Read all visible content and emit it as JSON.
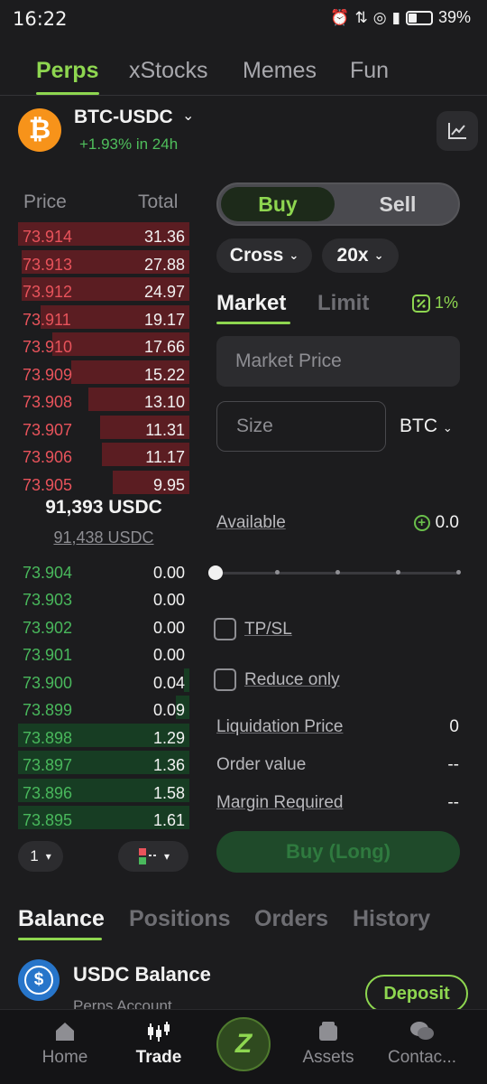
{
  "status_bar": {
    "time": "16:22",
    "battery": "39%"
  },
  "top_tabs": [
    {
      "label": "Perps"
    },
    {
      "label": "xStocks"
    },
    {
      "label": "Memes"
    },
    {
      "label": "Fun"
    }
  ],
  "market": {
    "pair": "BTC-USDC",
    "change": "+1.93% in 24h",
    "coin_icon": "bitcoin-icon"
  },
  "orderbook": {
    "price_header": "Price",
    "total_header": "Total",
    "asks": [
      {
        "price": "73.914",
        "total": "31.36",
        "depth": 1.0
      },
      {
        "price": "73.913",
        "total": "27.88",
        "depth": 0.98
      },
      {
        "price": "73.912",
        "total": "24.97",
        "depth": 0.98
      },
      {
        "price": "73.911",
        "total": "19.17",
        "depth": 0.87
      },
      {
        "price": "73.910",
        "total": "17.66",
        "depth": 0.8
      },
      {
        "price": "73.909",
        "total": "15.22",
        "depth": 0.69
      },
      {
        "price": "73.908",
        "total": "13.10",
        "depth": 0.59
      },
      {
        "price": "73.907",
        "total": "11.31",
        "depth": 0.52
      },
      {
        "price": "73.906",
        "total": "11.17",
        "depth": 0.51
      },
      {
        "price": "73.905",
        "total": "9.95",
        "depth": 0.45
      }
    ],
    "mid_price": "91,393 USDC",
    "mark_price": "91,438 USDC",
    "bids": [
      {
        "price": "73.904",
        "total": "0.00",
        "depth": 0.0
      },
      {
        "price": "73.903",
        "total": "0.00",
        "depth": 0.0
      },
      {
        "price": "73.902",
        "total": "0.00",
        "depth": 0.0
      },
      {
        "price": "73.901",
        "total": "0.00",
        "depth": 0.0
      },
      {
        "price": "73.900",
        "total": "0.04",
        "depth": 0.03
      },
      {
        "price": "73.899",
        "total": "0.09",
        "depth": 0.08
      },
      {
        "price": "73.898",
        "total": "1.29",
        "depth": 1.0
      },
      {
        "price": "73.897",
        "total": "1.36",
        "depth": 1.0
      },
      {
        "price": "73.896",
        "total": "1.58",
        "depth": 1.0
      },
      {
        "price": "73.895",
        "total": "1.61",
        "depth": 1.0
      }
    ],
    "precision_select": "1"
  },
  "order_form": {
    "buy_label": "Buy",
    "sell_label": "Sell",
    "margin_mode": "Cross",
    "leverage": "20x",
    "market_tab": "Market",
    "limit_tab": "Limit",
    "slippage": "1%",
    "market_price_placeholder": "Market Price",
    "size_placeholder": "Size",
    "size_unit": "BTC",
    "available_label": "Available",
    "available_value": "0.0",
    "tpsl_label": "TP/SL",
    "reduce_only_label": "Reduce only",
    "liquidation_label": "Liquidation Price",
    "liquidation_value": "0",
    "order_value_label": "Order value",
    "order_value_value": "--",
    "margin_label": "Margin Required",
    "margin_value": "--",
    "submit_label": "Buy (Long)"
  },
  "bottom_tabs": [
    {
      "label": "Balance"
    },
    {
      "label": "Positions"
    },
    {
      "label": "Orders"
    },
    {
      "label": "History"
    }
  ],
  "balance": {
    "title": "USDC Balance",
    "subtitle": "Perps Account",
    "deposit_label": "Deposit"
  },
  "nav": [
    {
      "label": "Home",
      "icon": "home-icon"
    },
    {
      "label": "Trade",
      "icon": "candlestick-icon"
    },
    {
      "label": "Assets",
      "icon": "wallet-icon"
    },
    {
      "label": "Contac...",
      "icon": "chat-icon"
    }
  ],
  "colors": {
    "accent": "#8ed650",
    "ask": "#e8535b",
    "bid": "#49b85c",
    "background": "#1c1c1e"
  }
}
